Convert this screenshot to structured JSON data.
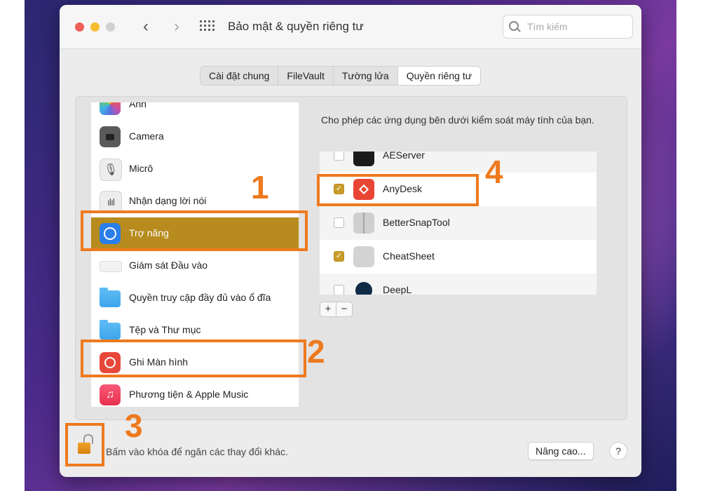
{
  "window": {
    "title": "Bảo mật & quyền riêng tư",
    "search_placeholder": "Tìm kiếm"
  },
  "tabs": [
    {
      "label": "Cài đặt chung",
      "active": false
    },
    {
      "label": "FileVault",
      "active": false
    },
    {
      "label": "Tường lửa",
      "active": false
    },
    {
      "label": "Quyền riêng tư",
      "active": true
    }
  ],
  "sidebar": {
    "items": [
      {
        "label": "Ảnh",
        "icon": "photos-icon"
      },
      {
        "label": "Camera",
        "icon": "camera-icon"
      },
      {
        "label": "Micrô",
        "icon": "microphone-icon"
      },
      {
        "label": "Nhận dạng lời nói",
        "icon": "speech-recognition-icon"
      },
      {
        "label": "Trợ năng",
        "icon": "accessibility-icon",
        "selected": true
      },
      {
        "label": "Giám sát Đầu vào",
        "icon": "keyboard-icon"
      },
      {
        "label": "Quyền truy cập đầy đủ vào ổ đĩa",
        "icon": "folder-icon"
      },
      {
        "label": "Tệp và Thư mục",
        "icon": "folder-icon"
      },
      {
        "label": "Ghi Màn hình",
        "icon": "screen-recording-icon"
      },
      {
        "label": "Phương tiện & Apple Music",
        "icon": "music-icon"
      }
    ]
  },
  "main": {
    "description": "Cho phép các ứng dụng bên dưới kiểm soát máy tính của bạn.",
    "apps": [
      {
        "name": "AEServer",
        "checked": false,
        "icon": "aeserver-icon"
      },
      {
        "name": "AnyDesk",
        "checked": true,
        "icon": "anydesk-icon"
      },
      {
        "name": "BetterSnapTool",
        "checked": false,
        "icon": "bettersnaptool-icon"
      },
      {
        "name": "CheatSheet",
        "checked": true,
        "icon": "cheatsheet-icon"
      },
      {
        "name": "DeepL",
        "checked": false,
        "icon": "deepl-icon"
      }
    ],
    "add_label": "+",
    "remove_label": "−",
    "checkmark": "✓"
  },
  "footer": {
    "lock_text": "Bấm vào khóa để ngăn các thay đổi khác.",
    "advanced_label": "Nâng cao...",
    "help_label": "?"
  },
  "annotations": {
    "step1": "1",
    "step2": "2",
    "step3": "3",
    "step4": "4",
    "color": "#ee7a1f"
  },
  "icons": {
    "back": "‹",
    "forward": "›",
    "microphone": "🎙",
    "speech": "ılıl",
    "music": "♫"
  },
  "colors": {
    "selection": "#b78b1d",
    "checkbox_checked": "#c99c2a",
    "close": "#ee5f57",
    "minimize": "#f5bd2f"
  }
}
